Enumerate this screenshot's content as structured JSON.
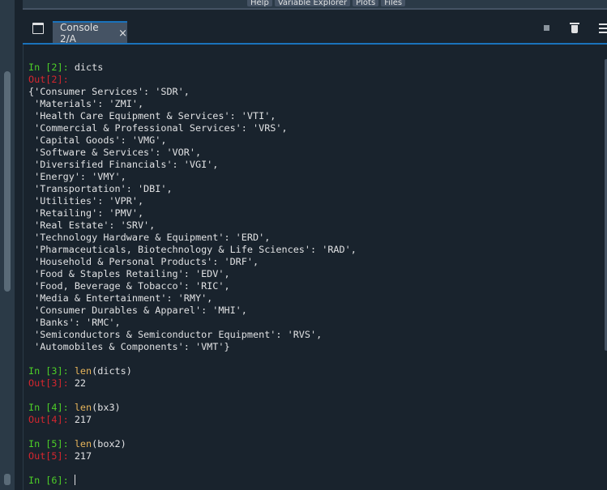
{
  "panel_tabs": [
    "Help",
    "Variable Explorer",
    "Plots",
    "Files"
  ],
  "console_tab": {
    "label": "Console 2/A",
    "close": "×"
  },
  "icons": {
    "browse": "browse-tabs-icon",
    "stop": "stop-icon",
    "clear": "trash-icon",
    "options": "hamburger-menu-icon"
  },
  "colors": {
    "background": "#19232d",
    "in_prompt": "#4dce28",
    "out_prompt": "#d4262e",
    "builtin": "#e6b45a",
    "accent": "#1a72bb"
  },
  "session": [
    {
      "in_prompt": "In [2]: ",
      "code": [
        {
          "t": "dicts"
        }
      ],
      "out_prompt": "Out[2]: ",
      "output_lines": [
        "{'Consumer Services': 'SDR',",
        " 'Materials': 'ZMI',",
        " 'Health Care Equipment & Services': 'VTI',",
        " 'Commercial & Professional Services': 'VRS',",
        " 'Capital Goods': 'VMG',",
        " 'Software & Services': 'VOR',",
        " 'Diversified Financials': 'VGI',",
        " 'Energy': 'VMY',",
        " 'Transportation': 'DBI',",
        " 'Utilities': 'VPR',",
        " 'Retailing': 'PMV',",
        " 'Real Estate': 'SRV',",
        " 'Technology Hardware & Equipment': 'ERD',",
        " 'Pharmaceuticals, Biotechnology & Life Sciences': 'RAD',",
        " 'Household & Personal Products': 'DRF',",
        " 'Food & Staples Retailing': 'EDV',",
        " 'Food, Beverage & Tobacco': 'RIC',",
        " 'Media & Entertainment': 'RMY',",
        " 'Consumer Durables & Apparel': 'MHI',",
        " 'Banks': 'RMC',",
        " 'Semiconductors & Semiconductor Equipment': 'RVS',",
        " 'Automobiles & Components': 'VMT'}"
      ],
      "inline_output": false
    },
    {
      "in_prompt": "In [3]: ",
      "code": [
        {
          "t": "len",
          "fn": true
        },
        {
          "t": "(dicts)"
        }
      ],
      "out_prompt": "Out[3]: ",
      "output_lines": [
        "22"
      ],
      "inline_output": true
    },
    {
      "in_prompt": "In [4]: ",
      "code": [
        {
          "t": "len",
          "fn": true
        },
        {
          "t": "(bx3)"
        }
      ],
      "out_prompt": "Out[4]: ",
      "output_lines": [
        "217"
      ],
      "inline_output": true
    },
    {
      "in_prompt": "In [5]: ",
      "code": [
        {
          "t": "len",
          "fn": true
        },
        {
          "t": "(box2)"
        }
      ],
      "out_prompt": "Out[5]: ",
      "output_lines": [
        "217"
      ],
      "inline_output": true
    }
  ],
  "current_prompt": "In [6]: "
}
